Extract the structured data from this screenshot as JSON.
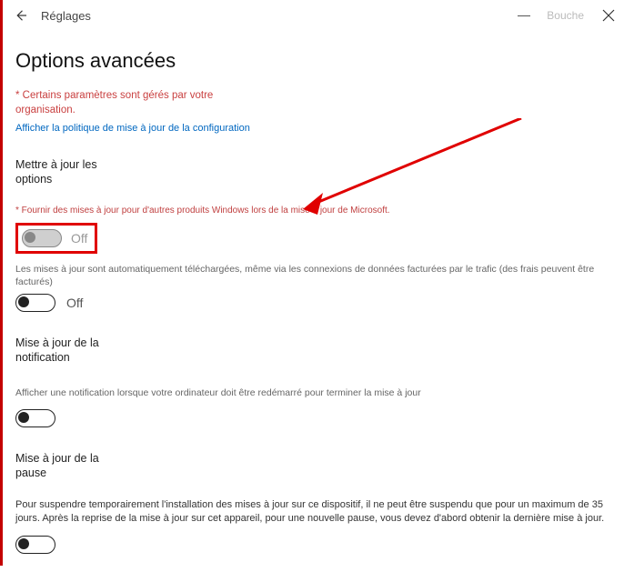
{
  "titlebar": {
    "title": "Réglages",
    "dim_text": "Bouche"
  },
  "page": {
    "title": "Options avancées"
  },
  "managed": {
    "text": "* Certains paramètres sont gérés par votre organisation.",
    "link": "Afficher la politique de mise à jour de la configuration"
  },
  "section_update_options": {
    "heading": "Mettre à jour les options",
    "note_red": "* Fournir des mises à jour pour d'autres produits Windows lors de la mise à jour de Microsoft.",
    "toggle1_label": "Off",
    "desc2": "Les mises à jour sont automatiquement téléchargées, même via les connexions de données facturées par le trafic (des frais peuvent être facturés)",
    "toggle2_label": "Off"
  },
  "section_notification": {
    "heading": "Mise à jour de la notification",
    "desc": "Afficher une notification lorsque votre ordinateur doit être redémarré pour terminer la mise à jour"
  },
  "section_pause": {
    "heading": "Mise à jour de la pause",
    "desc": "Pour suspendre temporairement l'installation des mises à jour sur ce dispositif, il ne peut être suspendu que pour un maximum de 35 jours. Après la reprise de la mise à jour sur cet appareil, pour une nouvelle pause, vous devez d'abord obtenir la dernière mise à jour."
  }
}
